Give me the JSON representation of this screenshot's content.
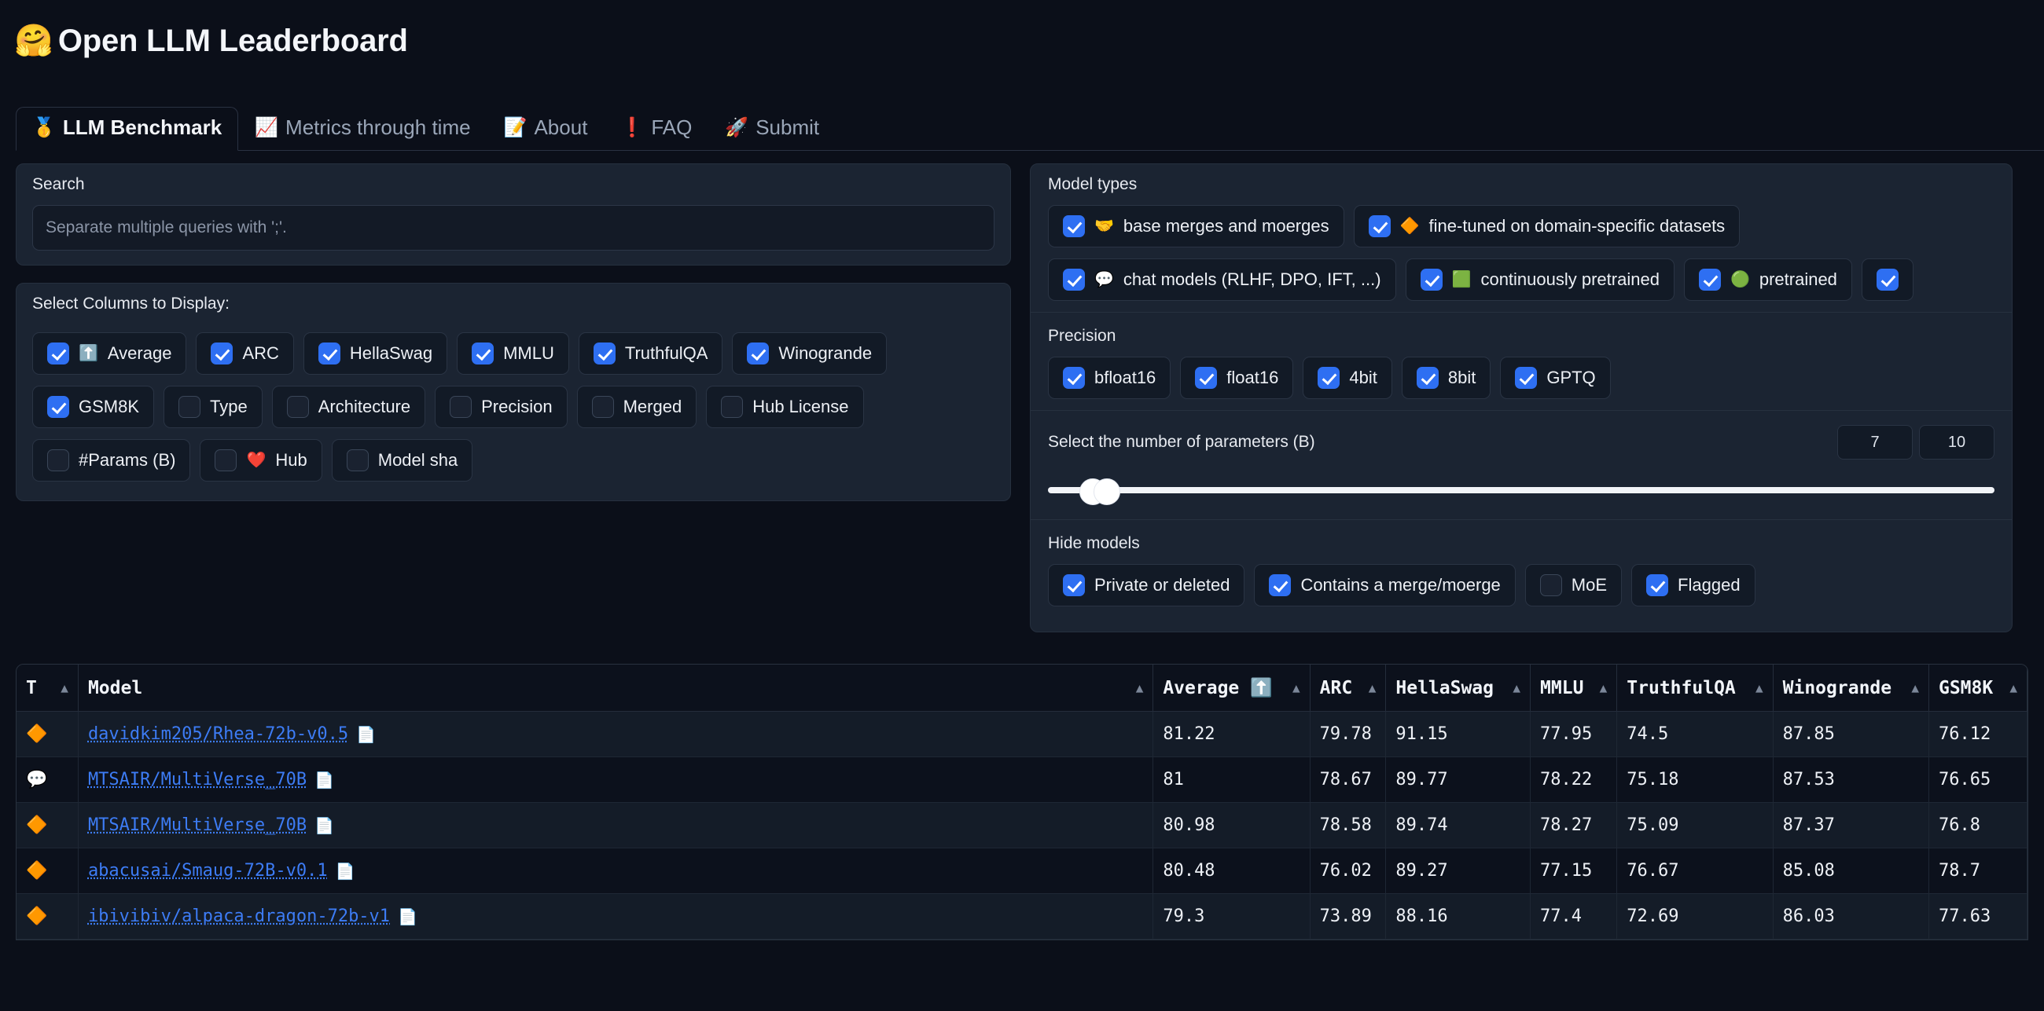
{
  "header": {
    "logo_icon": "hugging-face-emoji",
    "logo_glyph": "🤗",
    "title": "Open LLM Leaderboard"
  },
  "tabs": [
    {
      "label": "LLM Benchmark",
      "icon": "medal-icon",
      "glyph": "🥇",
      "active": true
    },
    {
      "label": "Metrics through time",
      "icon": "chart-increasing-icon",
      "glyph": "📈",
      "active": false
    },
    {
      "label": "About",
      "icon": "memo-icon",
      "glyph": "📝",
      "active": false
    },
    {
      "label": "FAQ",
      "icon": "exclamation-mark-icon",
      "glyph": "❗",
      "active": false
    },
    {
      "label": "Submit",
      "icon": "rocket-icon",
      "glyph": "🚀",
      "active": false
    }
  ],
  "search": {
    "label": "Search",
    "value": "",
    "placeholder": "Separate multiple queries with ';'."
  },
  "columns": {
    "label": "Select Columns to Display:",
    "rows": [
      [
        {
          "label": "Average",
          "glyph": "⬆️",
          "checked": true
        },
        {
          "label": "ARC",
          "glyph": "",
          "checked": true
        },
        {
          "label": "HellaSwag",
          "glyph": "",
          "checked": true
        },
        {
          "label": "MMLU",
          "glyph": "",
          "checked": true
        },
        {
          "label": "TruthfulQA",
          "glyph": "",
          "checked": true
        },
        {
          "label": "Winogrande",
          "glyph": "",
          "checked": true
        }
      ],
      [
        {
          "label": "GSM8K",
          "glyph": "",
          "checked": true
        },
        {
          "label": "Type",
          "glyph": "",
          "checked": false
        },
        {
          "label": "Architecture",
          "glyph": "",
          "checked": false
        },
        {
          "label": "Precision",
          "glyph": "",
          "checked": false
        },
        {
          "label": "Merged",
          "glyph": "",
          "checked": false
        },
        {
          "label": "Hub License",
          "glyph": "",
          "checked": false
        }
      ],
      [
        {
          "label": "#Params (B)",
          "glyph": "",
          "checked": false
        },
        {
          "label": "Hub",
          "glyph": "❤️",
          "checked": false
        },
        {
          "label": "Model sha",
          "glyph": "",
          "checked": false
        }
      ]
    ]
  },
  "model_types": {
    "title": "Model types",
    "rows": [
      [
        {
          "label": "base merges and moerges",
          "glyph": "🤝",
          "checked": true
        },
        {
          "label": "fine-tuned on domain-specific datasets",
          "glyph": "🔶",
          "checked": true
        }
      ],
      [
        {
          "label": "chat models (RLHF, DPO, IFT, ...)",
          "glyph": "💬",
          "checked": true
        },
        {
          "label": "continuously pretrained",
          "glyph": "🟩",
          "checked": true
        },
        {
          "label": "pretrained",
          "glyph": "🟢",
          "checked": true
        },
        {
          "label": "",
          "glyph": "",
          "checked": true
        }
      ]
    ]
  },
  "precision": {
    "title": "Precision",
    "options": [
      {
        "label": "bfloat16",
        "checked": true
      },
      {
        "label": "float16",
        "checked": true
      },
      {
        "label": "4bit",
        "checked": true
      },
      {
        "label": "8bit",
        "checked": true
      },
      {
        "label": "GPTQ",
        "checked": true
      }
    ]
  },
  "params": {
    "title": "Select the number of parameters (B)",
    "min_value": "7",
    "max_value": "10"
  },
  "hide_models": {
    "title": "Hide models",
    "options": [
      {
        "label": "Private or deleted",
        "checked": true
      },
      {
        "label": "Contains a merge/moerge",
        "checked": true
      },
      {
        "label": "MoE",
        "checked": false
      },
      {
        "label": "Flagged",
        "checked": true
      }
    ]
  },
  "table": {
    "headers": [
      {
        "label": "T",
        "sort": "▲"
      },
      {
        "label": "Model",
        "sort": "▲"
      },
      {
        "label": "Average",
        "glyph": "⬆️",
        "sort": "▲"
      },
      {
        "label": "ARC",
        "sort": "▲"
      },
      {
        "label": "HellaSwag",
        "sort": "▲"
      },
      {
        "label": "MMLU",
        "sort": "▲"
      },
      {
        "label": "TruthfulQA",
        "sort": "▲"
      },
      {
        "label": "Winogrande",
        "sort": "▲"
      },
      {
        "label": "GSM8K",
        "sort": "▲"
      }
    ],
    "rows": [
      {
        "type_glyph": "🔶",
        "type_name": "fine-tuned-marker",
        "model": "davidkim205/Rhea-72b-v0.5",
        "page_glyph": "📄",
        "average": "81.22",
        "arc": "79.78",
        "hellaswag": "91.15",
        "mmlu": "77.95",
        "truthfulqa": "74.5",
        "winogrande": "87.85",
        "gsm8k": "76.12"
      },
      {
        "type_glyph": "💬",
        "type_name": "chat-model-marker",
        "model": "MTSAIR/MultiVerse_70B",
        "page_glyph": "📄",
        "average": "81",
        "arc": "78.67",
        "hellaswag": "89.77",
        "mmlu": "78.22",
        "truthfulqa": "75.18",
        "winogrande": "87.53",
        "gsm8k": "76.65"
      },
      {
        "type_glyph": "🔶",
        "type_name": "fine-tuned-marker",
        "model": "MTSAIR/MultiVerse_70B",
        "page_glyph": "📄",
        "average": "80.98",
        "arc": "78.58",
        "hellaswag": "89.74",
        "mmlu": "78.27",
        "truthfulqa": "75.09",
        "winogrande": "87.37",
        "gsm8k": "76.8"
      },
      {
        "type_glyph": "🔶",
        "type_name": "fine-tuned-marker",
        "model": "abacusai/Smaug-72B-v0.1",
        "page_glyph": "📄",
        "average": "80.48",
        "arc": "76.02",
        "hellaswag": "89.27",
        "mmlu": "77.15",
        "truthfulqa": "76.67",
        "winogrande": "85.08",
        "gsm8k": "78.7"
      },
      {
        "type_glyph": "🔶",
        "type_name": "fine-tuned-marker",
        "model": "ibivibiv/alpaca-dragon-72b-v1",
        "page_glyph": "📄",
        "average": "79.3",
        "arc": "73.89",
        "hellaswag": "88.16",
        "mmlu": "77.4",
        "truthfulqa": "72.69",
        "winogrande": "86.03",
        "gsm8k": "77.63"
      }
    ]
  },
  "colors": {
    "accent": "#2e6ff2",
    "link": "#3d7cf5",
    "page_bg": "#0b0f19",
    "panel_bg": "#1b2432",
    "chip_bg": "#121a26"
  }
}
